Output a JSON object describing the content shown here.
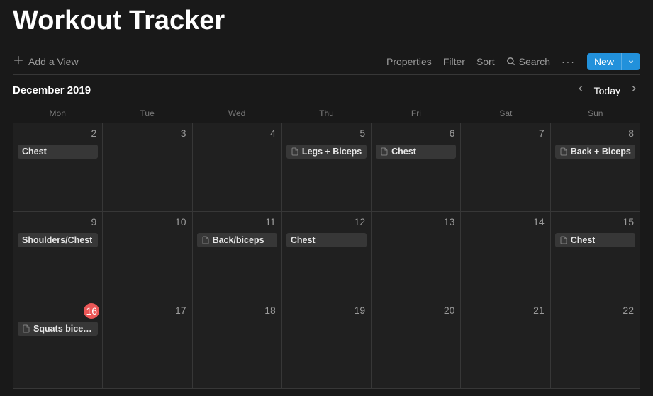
{
  "page": {
    "title": "Workout Tracker"
  },
  "toolbar": {
    "add_view": "Add a View",
    "properties": "Properties",
    "filter": "Filter",
    "sort": "Sort",
    "search": "Search",
    "new": "New"
  },
  "calendar": {
    "month_label": "December 2019",
    "today": "Today",
    "weekdays": [
      "Mon",
      "Tue",
      "Wed",
      "Thu",
      "Fri",
      "Sat",
      "Sun"
    ],
    "cells": [
      {
        "day": "2",
        "today": false,
        "events": [
          {
            "icon": false,
            "label": "Chest"
          }
        ]
      },
      {
        "day": "3",
        "today": false,
        "events": []
      },
      {
        "day": "4",
        "today": false,
        "events": []
      },
      {
        "day": "5",
        "today": false,
        "events": [
          {
            "icon": true,
            "label": "Legs + Biceps"
          }
        ]
      },
      {
        "day": "6",
        "today": false,
        "events": [
          {
            "icon": true,
            "label": "Chest"
          }
        ]
      },
      {
        "day": "7",
        "today": false,
        "events": []
      },
      {
        "day": "8",
        "today": false,
        "events": [
          {
            "icon": true,
            "label": "Back + Biceps"
          }
        ]
      },
      {
        "day": "9",
        "today": false,
        "events": [
          {
            "icon": false,
            "label": "Shoulders/Chest"
          }
        ]
      },
      {
        "day": "10",
        "today": false,
        "events": []
      },
      {
        "day": "11",
        "today": false,
        "events": [
          {
            "icon": true,
            "label": "Back/biceps"
          }
        ]
      },
      {
        "day": "12",
        "today": false,
        "events": [
          {
            "icon": false,
            "label": "Chest"
          }
        ]
      },
      {
        "day": "13",
        "today": false,
        "events": []
      },
      {
        "day": "14",
        "today": false,
        "events": []
      },
      {
        "day": "15",
        "today": false,
        "events": [
          {
            "icon": true,
            "label": "Chest"
          }
        ]
      },
      {
        "day": "16",
        "today": true,
        "events": [
          {
            "icon": true,
            "label": "Squats bice…"
          }
        ]
      },
      {
        "day": "17",
        "today": false,
        "events": []
      },
      {
        "day": "18",
        "today": false,
        "events": []
      },
      {
        "day": "19",
        "today": false,
        "events": []
      },
      {
        "day": "20",
        "today": false,
        "events": []
      },
      {
        "day": "21",
        "today": false,
        "events": []
      },
      {
        "day": "22",
        "today": false,
        "events": []
      }
    ]
  }
}
